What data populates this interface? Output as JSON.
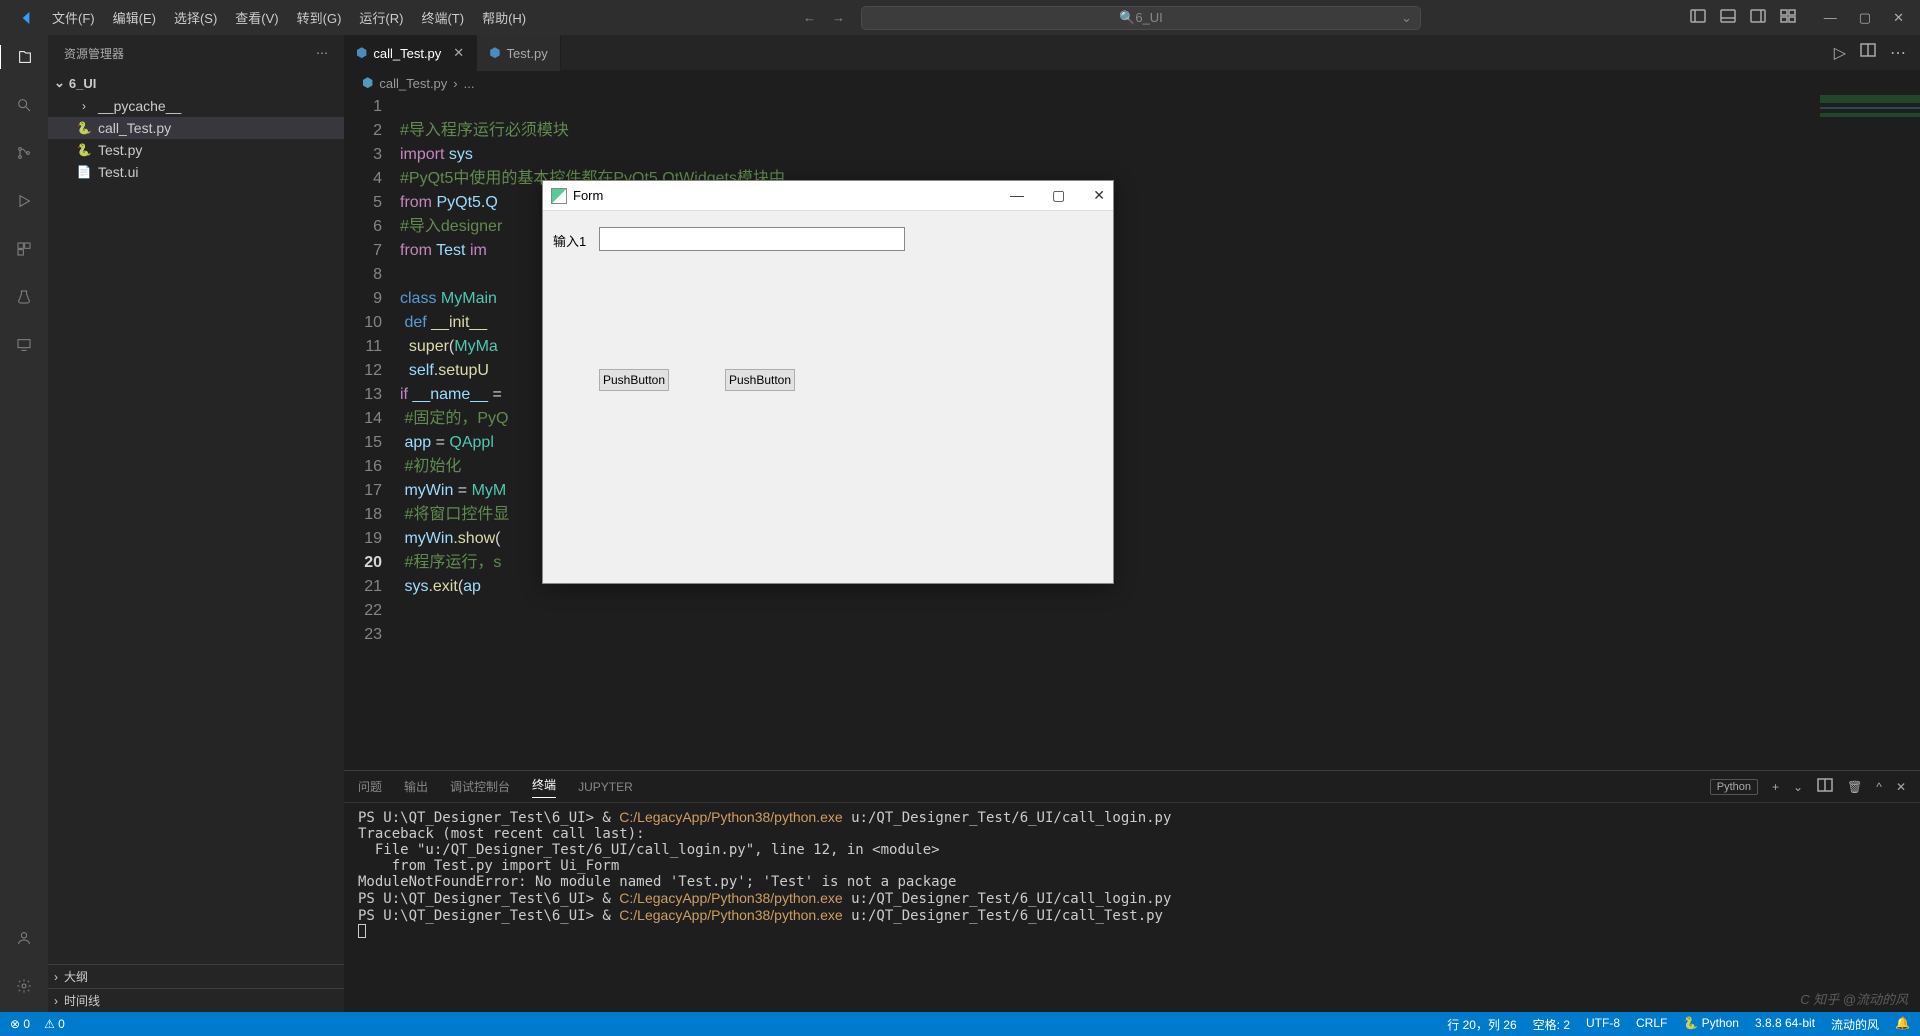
{
  "titlebar": {
    "menus": [
      "文件(F)",
      "编辑(E)",
      "选择(S)",
      "查看(V)",
      "转到(G)",
      "运行(R)",
      "终端(T)",
      "帮助(H)"
    ],
    "search_display": "6_UI"
  },
  "sidebar": {
    "title": "资源管理器",
    "folder": "6_UI",
    "files": [
      {
        "name": "__pycache__",
        "icon": "›",
        "type": "folder"
      },
      {
        "name": "call_Test.py",
        "icon": "py",
        "selected": true
      },
      {
        "name": "Test.py",
        "icon": "py"
      },
      {
        "name": "Test.ui",
        "icon": "ui"
      }
    ],
    "outline": "大纲",
    "timeline": "时间线"
  },
  "tabs": [
    {
      "label": "call_Test.py",
      "active": true
    },
    {
      "label": "Test.py",
      "active": false
    }
  ],
  "breadcrumb": {
    "file": "call_Test.py",
    "more": "..."
  },
  "code": {
    "lines": [
      {
        "n": 1,
        "html": ""
      },
      {
        "n": 2,
        "html": "<span class='c-comment'>#导入程序运行必须模块</span>"
      },
      {
        "n": 3,
        "html": "<span class='c-keyword2'>import</span> <span class='c-var'>sys</span>"
      },
      {
        "n": 4,
        "html": "<span class='c-comment'>#PyQt5中使用的基本控件都在PyQt5.QtWidgets模块中</span>"
      },
      {
        "n": 5,
        "html": "<span class='c-keyword2'>from</span> <span class='c-var'>PyQt5</span><span class='c-plain'>.</span><span class='c-var'>Q</span>"
      },
      {
        "n": 6,
        "html": "<span class='c-comment'>#导入designer</span>"
      },
      {
        "n": 7,
        "html": "<span class='c-keyword2'>from</span> <span class='c-var'>Test</span> <span class='c-keyword2'>im</span>"
      },
      {
        "n": 8,
        "html": ""
      },
      {
        "n": 9,
        "html": "<span class='c-keyword'>class</span> <span class='c-class'>MyMain</span>"
      },
      {
        "n": 10,
        "html": " <span class='c-keyword'>def</span> <span class='c-func'>__init__</span>"
      },
      {
        "n": 11,
        "html": "  <span class='c-func'>super</span><span class='c-plain'>(</span><span class='c-class'>MyMa</span>"
      },
      {
        "n": 12,
        "html": "  <span class='c-var'>self</span><span class='c-plain'>.</span><span class='c-func'>setupU</span>"
      },
      {
        "n": 13,
        "html": "<span class='c-keyword2'>if</span> <span class='c-var'>__name__</span> <span class='c-plain'>=</span>"
      },
      {
        "n": 14,
        "html": " <span class='c-comment'>#固定的，PyQ</span>                                                            <span class='c-comment'>序可以双击运行</span>"
      },
      {
        "n": 15,
        "html": " <span class='c-var'>app</span> <span class='c-plain'>=</span> <span class='c-class'>QAppl</span>"
      },
      {
        "n": 16,
        "html": " <span class='c-comment'>#初始化</span>"
      },
      {
        "n": 17,
        "html": " <span class='c-var'>myWin</span> <span class='c-plain'>=</span> <span class='c-class'>MyM</span>"
      },
      {
        "n": 18,
        "html": " <span class='c-comment'>#将窗口控件显</span>"
      },
      {
        "n": 19,
        "html": " <span class='c-var'>myWin</span><span class='c-plain'>.</span><span class='c-func'>show</span><span class='c-plain'>(</span>"
      },
      {
        "n": 20,
        "html": " <span class='c-comment'>#程序运行，s</span>",
        "current": true
      },
      {
        "n": 21,
        "html": " <span class='c-var'>sys</span><span class='c-plain'>.</span><span class='c-func'>exit</span><span class='c-plain'>(</span><span class='c-var'>ap</span>"
      },
      {
        "n": 22,
        "html": ""
      },
      {
        "n": 23,
        "html": ""
      }
    ]
  },
  "panel": {
    "tabs": [
      "问题",
      "输出",
      "调试控制台",
      "终端",
      "JUPYTER"
    ],
    "active_tab": 3,
    "python_label": "Python",
    "terminal_lines": [
      "PS U:\\QT_Designer_Test\\6_UI> & <span class='t-yellow'>C:/LegacyApp/Python38/python.exe</span> u:/QT_Designer_Test/6_UI/call_login.py",
      "Traceback (most recent call last):",
      "  File \"u:/QT_Designer_Test/6_UI/call_login.py\", line 12, in &lt;module&gt;",
      "    from Test.py import Ui_Form",
      "ModuleNotFoundError: No module named 'Test.py'; 'Test' is not a package",
      "PS U:\\QT_Designer_Test\\6_UI> & <span class='t-yellow'>C:/LegacyApp/Python38/python.exe</span> u:/QT_Designer_Test/6_UI/call_login.py",
      "PS U:\\QT_Designer_Test\\6_UI> & <span class='t-yellow'>C:/LegacyApp/Python38/python.exe</span> u:/QT_Designer_Test/6_UI/call_Test.py",
      "<span class='t-cursor'></span>"
    ]
  },
  "statusbar": {
    "left": [
      "⊗ 0",
      "⚠ 0"
    ],
    "right": [
      "行 20，列 26",
      "空格: 2",
      "UTF-8",
      "CRLF",
      "🐍 Python",
      "3.8.8 64-bit",
      "流动的风",
      "🔔"
    ]
  },
  "qt": {
    "title": "Form",
    "label": "输入1",
    "btn1": "PushButton",
    "btn2": "PushButton"
  }
}
